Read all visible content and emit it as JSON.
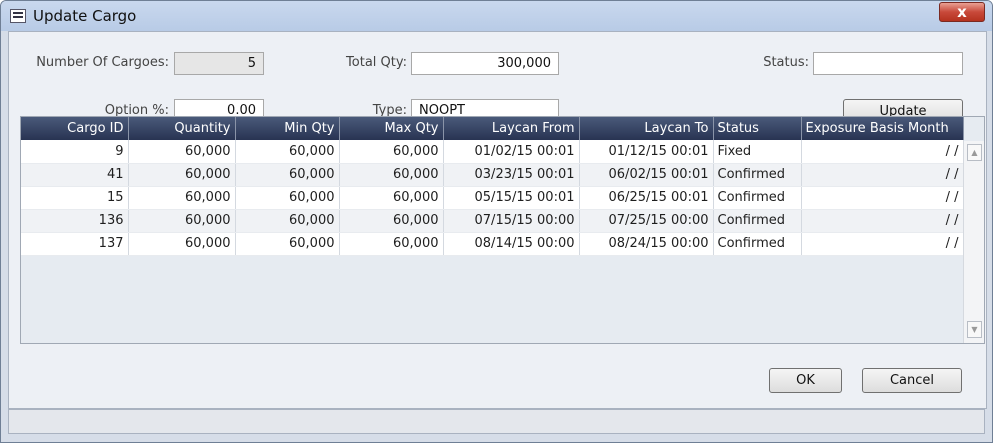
{
  "window": {
    "title": "Update Cargo",
    "close_glyph": "x"
  },
  "form": {
    "number_of_cargoes_label": "Number Of Cargoes:",
    "number_of_cargoes_value": "5",
    "total_qty_label": "Total Qty:",
    "total_qty_value": "300,000",
    "status_label": "Status:",
    "status_value": "",
    "option_pct_label": "Option %:",
    "option_pct_value": "0.00",
    "type_label": "Type:",
    "type_value": "NOOPT",
    "update_label": "Update"
  },
  "grid": {
    "columns": [
      "Cargo ID",
      "Quantity",
      "Min Qty",
      "Max Qty",
      "Laycan From",
      "Laycan To",
      "Status",
      "Exposure Basis Month"
    ],
    "rows": [
      [
        "9",
        "60,000",
        "60,000",
        "60,000",
        "01/02/15 00:01",
        "01/12/15 00:01",
        "Fixed",
        "/ /"
      ],
      [
        "41",
        "60,000",
        "60,000",
        "60,000",
        "03/23/15 00:01",
        "06/02/15 00:01",
        "Confirmed",
        "/ /"
      ],
      [
        "15",
        "60,000",
        "60,000",
        "60,000",
        "05/15/15 00:01",
        "06/25/15 00:01",
        "Confirmed",
        "/ /"
      ],
      [
        "136",
        "60,000",
        "60,000",
        "60,000",
        "07/15/15 00:00",
        "07/25/15 00:00",
        "Confirmed",
        "/ /"
      ],
      [
        "137",
        "60,000",
        "60,000",
        "60,000",
        "08/14/15 00:00",
        "08/24/15 00:00",
        "Confirmed",
        "/ /"
      ]
    ]
  },
  "footer": {
    "ok_label": "OK",
    "cancel_label": "Cancel"
  }
}
